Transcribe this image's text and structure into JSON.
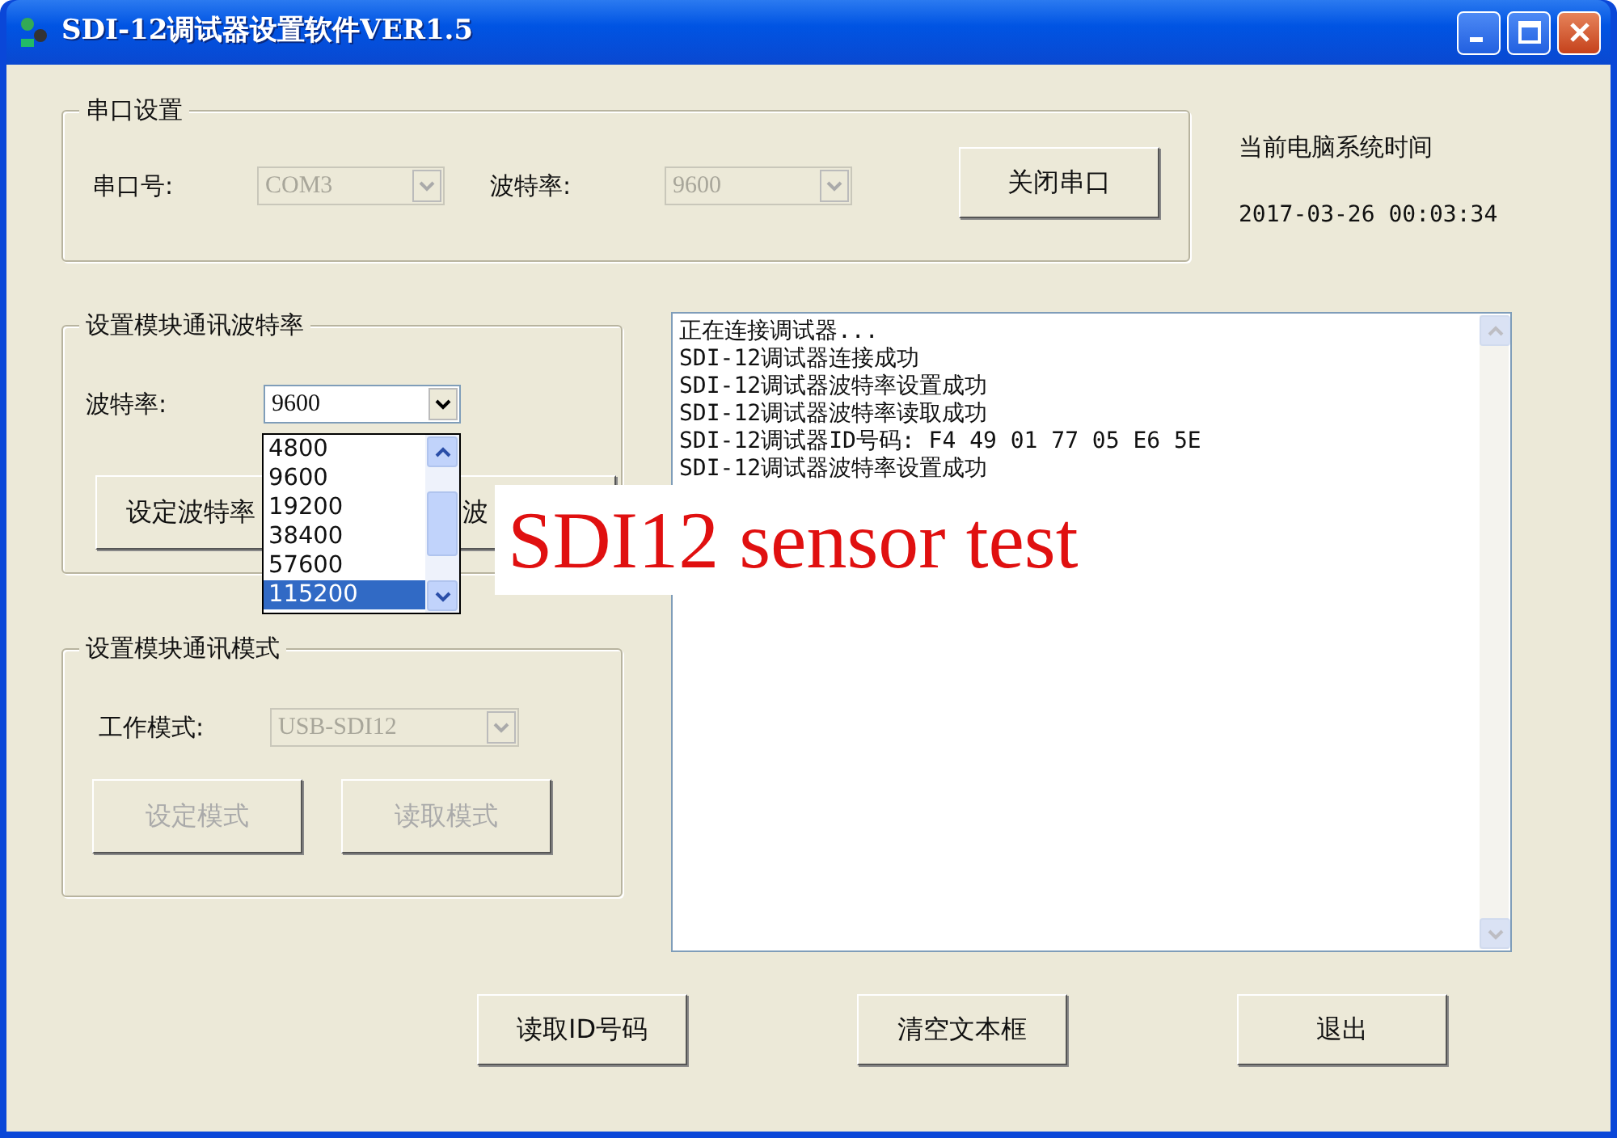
{
  "window": {
    "title": "SDI-12调试器设置软件VER1.5"
  },
  "serial_group": {
    "title": "串口设置",
    "fields": [
      {
        "label": "串口号:",
        "value": "COM3",
        "disabled": true
      },
      {
        "label": "波特率:",
        "value": "9600",
        "disabled": true
      }
    ],
    "button": {
      "label": "关闭串口",
      "disabled": false
    }
  },
  "clock": {
    "label": "当前电脑系统时间",
    "time": "2017-03-26 00:03:34"
  },
  "baud_group": {
    "title": "设置模块通讯波特率",
    "field": {
      "label": "波特率:",
      "value": "9600",
      "disabled": false,
      "expanded": true
    },
    "options": [
      {
        "label": "4800",
        "selected": false
      },
      {
        "label": "9600",
        "selected": false
      },
      {
        "label": "19200",
        "selected": false
      },
      {
        "label": "38400",
        "selected": false
      },
      {
        "label": "57600",
        "selected": false
      },
      {
        "label": "115200",
        "selected": true
      }
    ],
    "buttons": [
      {
        "label": "设定波特率",
        "disabled": false
      },
      {
        "label": "波",
        "disabled": false
      }
    ]
  },
  "mode_group": {
    "title": "设置模块通讯模式",
    "field": {
      "label": "工作模式:",
      "value": "USB-SDI12",
      "disabled": true
    },
    "buttons": [
      {
        "label": "设定模式",
        "disabled": true
      },
      {
        "label": "读取模式",
        "disabled": true
      }
    ]
  },
  "log": {
    "lines": [
      "正在连接调试器...",
      "SDI-12调试器连接成功",
      "SDI-12调试器波特率设置成功",
      "SDI-12调试器波特率读取成功",
      "SDI-12调试器ID号码: F4 49 01 77 05 E6 5E",
      "SDI-12调试器波特率设置成功"
    ]
  },
  "buttons": [
    {
      "label": "读取ID号码",
      "disabled": false
    },
    {
      "label": "清空文本框",
      "disabled": false
    },
    {
      "label": "退出",
      "disabled": false
    }
  ],
  "overlay_caption": "SDI12 sensor test"
}
